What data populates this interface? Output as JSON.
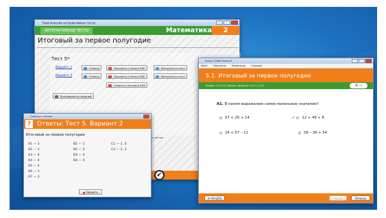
{
  "win1": {
    "title": "Тематические интерактивные тесты",
    "tab": "ИНТЕРАКТИВНЫЕ ТЕСТЫ",
    "subject": "Математика",
    "grade": "2 класс",
    "heading": "Итоговый за первое полугодие",
    "test_label": "Тест 5*",
    "variant1": "Вариант 1",
    "variant2": "Вариант 2",
    "btn_answers": "Ответы",
    "btn_print": "Просмотр / печать PDF",
    "btn_upload": "Выгрузить в сеть",
    "btn_answers_tests": "Ответы к тестам в PDF",
    "btn_all_variants": "Все варианты заданий",
    "footnote": "* – ответы к тестам в PDF отличаются от ответов в интерактивных вариантах тестов"
  },
  "win2": {
    "title": "Ответы к тестам",
    "header": "Ответы: Тест 5. Вариант 2",
    "subtitle": "Итоговый за первое полугодие",
    "col_a": [
      "A1 — 3",
      "A2 — 3",
      "A3 — 4",
      "A4 — 4",
      "A5 — 2",
      "A6 — 1",
      "A7 — 3"
    ],
    "col_b": [
      "B1 — 1",
      "B2 — 2",
      "B3 — 4",
      "B4 — 4"
    ],
    "col_c": [
      "C1 — 1, 4",
      "C2 — 2, 3"
    ],
    "close": "Закрыть"
  },
  "win3": {
    "title": "Канал Плей Плеер III",
    "menu": [
      "Файл",
      "Просмотр",
      "Навигация",
      "Справка"
    ],
    "header": "5.1. Итоговый за первое полугодие",
    "status": "Вопрос 1 из 14 | Вопрос задания 1 из 1 | 1/17",
    "question_num": "А1.",
    "question": "В каком выражении самое маленькое значение?",
    "options": [
      "37 + 26 + 14",
      "12 + 49 + 8",
      "24 + 57 – 11",
      "58 – 39 + 54"
    ],
    "selected_option_index": 1,
    "btn_about": "Об ЦОЦ",
    "btn_back": "Назад",
    "btn_next": "Вперед"
  }
}
